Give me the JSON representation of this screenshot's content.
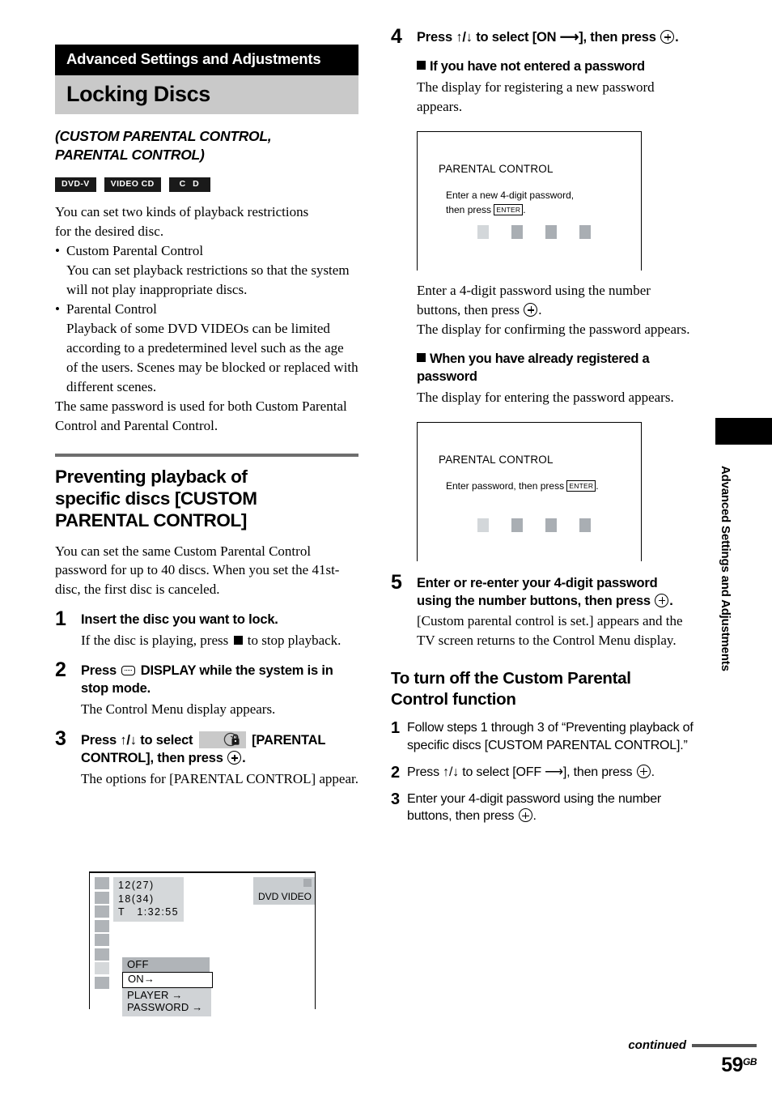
{
  "chapter_band": "Advanced Settings and Adjustments",
  "page_title": "Locking Discs",
  "subtitle_line1": "(CUSTOM PARENTAL CONTROL,",
  "subtitle_line2": "PARENTAL CONTROL)",
  "badges": [
    {
      "label": "DVD-V"
    },
    {
      "label": "VIDEO CD"
    },
    {
      "label": "C D"
    }
  ],
  "intro": {
    "line1": "You can set two kinds of playback restrictions",
    "line2": "for the desired disc.",
    "bullet1_title": "Custom Parental Control",
    "bullet1_body": "You can set playback restrictions so that the system will not play inappropriate discs.",
    "bullet2_title": "Parental Control",
    "bullet2_body": "Playback of some DVD VIDEOs can be limited according to a predetermined level such as the age of the users. Scenes may be blocked or replaced with different scenes.",
    "closing": "The same password is used for both Custom Parental Control and Parental Control."
  },
  "section": {
    "heading_l1": "Preventing playback of",
    "heading_l2": "specific discs [CUSTOM",
    "heading_l3": "PARENTAL CONTROL]",
    "intro": "You can set the same Custom Parental Control password for up to 40 discs. When you set the 41st-disc, the first disc is canceled."
  },
  "steps": [
    {
      "num": "1",
      "title": "Insert the disc you want to lock.",
      "note_pre": "If the disc is playing, press",
      "note_post": "to stop playback."
    },
    {
      "num": "2",
      "title_pre": "Press",
      "title_post": "DISPLAY while the system is in stop mode.",
      "note": "The Control Menu display appears."
    },
    {
      "num": "3",
      "title_pre": "Press ↑/↓ to select",
      "title_mid": "[PARENTAL CONTROL], then press",
      "note": "The options for [PARENTAL CONTROL] appear."
    },
    {
      "num": "4",
      "title": "Press ↑/↓ to select [ON ⟶], then press"
    },
    {
      "num": "5",
      "title": "Enter or re-enter your 4-digit password using the number buttons, then press",
      "note": "[Custom parental control is set.] appears and the TV screen returns to the Control Menu display."
    }
  ],
  "osd": {
    "info_line1": "12(27)",
    "info_line2": "18(34)",
    "info_line3": "T   1:32:55",
    "disc_label": "DVD VIDEO",
    "opt_off": "OFF",
    "opt_on": "ON→",
    "opt_player": "PLAYER →",
    "opt_password": "PASSWORD →"
  },
  "right_col": {
    "subhead_not_entered": "If you have not entered a password",
    "not_entered_note": "The display for registering a new password appears.",
    "after_box1_note1_pre": "Enter a 4-digit password using the number buttons, then press",
    "after_box1_note2": "The display for confirming the password appears.",
    "subhead_registered_l1": "When you have already registered a",
    "subhead_registered_l2": "password",
    "registered_note": "The display for entering the password appears.",
    "turnoff_head_l1": "To turn off the Custom Parental",
    "turnoff_head_l2": "Control function",
    "turnoff_steps": [
      {
        "num": "1",
        "text": "Follow steps 1 through 3 of “Preventing playback of specific discs [CUSTOM PARENTAL CONTROL].”"
      },
      {
        "num": "2",
        "text": "Press ↑/↓ to select [OFF ⟶], then press"
      },
      {
        "num": "3",
        "text": "Enter your 4-digit password using the number buttons, then press"
      }
    ]
  },
  "tv_box_new": {
    "title": "PARENTAL CONTROL",
    "line1": "Enter a new 4-digit password,",
    "line2_pre": "then press",
    "key": "ENTER",
    "line2_post": "."
  },
  "tv_box_enter": {
    "title": "PARENTAL CONTROL",
    "line1_pre": "Enter password, then press",
    "key": "ENTER",
    "line1_post": "."
  },
  "side_tab_label": "Advanced Settings and Adjustments",
  "footer": {
    "continued": "continued",
    "page": "59",
    "page_suffix": "GB"
  }
}
